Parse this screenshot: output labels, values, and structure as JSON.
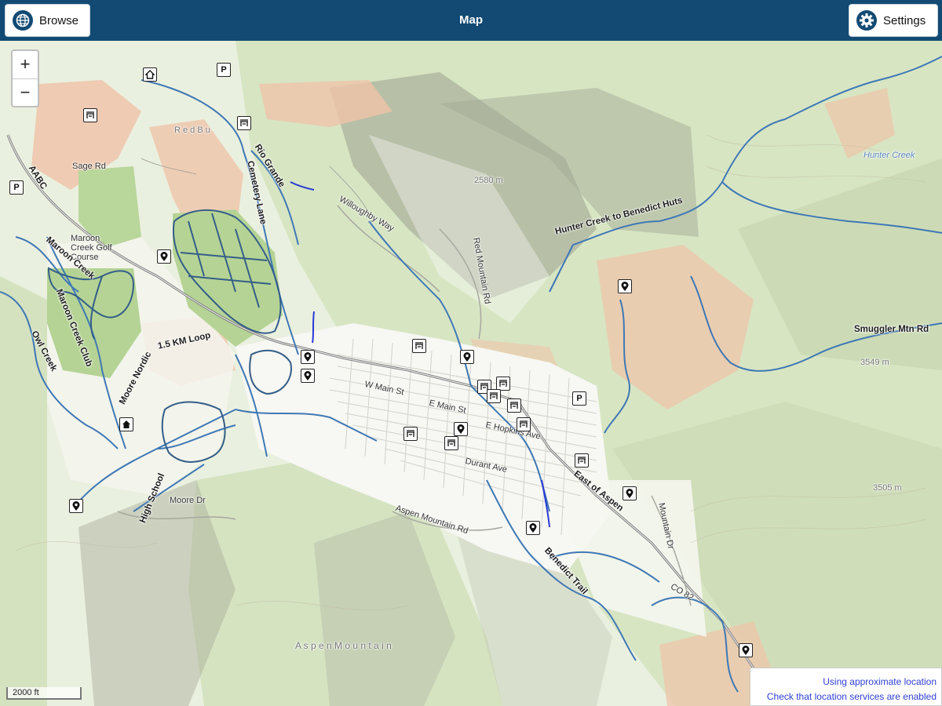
{
  "header": {
    "title": "Map",
    "browse_label": "Browse",
    "settings_label": "Settings"
  },
  "zoom": {
    "in": "+",
    "out": "−"
  },
  "scale_label": "2000 ft",
  "location_notice": {
    "line1": "Using approximate location",
    "line2": "Check that location services are enabled"
  },
  "map_labels": {
    "rio_grande": "Rio Grande",
    "cemetery_lane": "Cemetery Lane",
    "red_butte": "R e d  B u",
    "sage_rd": "Sage Rd",
    "aabc": "AABC",
    "maroon_golf": "Maroon Creek Golf Course",
    "maroon_creek_club": "Maroon Creek Club",
    "maroon_creek": "Maroon Creek",
    "owl_creek": "Owl Creek",
    "moore_nordic": "Moore Nordic",
    "loop": "1.5 KM Loop",
    "high_school": "High School",
    "moore_dr": "Moore Dr",
    "smuggler": "Smuggler Mtn Rd",
    "hunter_creek_trail": "Hunter Creek to Benedict Huts",
    "hunter_creek": "Hunter Creek",
    "elev_2580": "2580 m",
    "elev_3549": "3549 m",
    "elev_3505": "3505 m",
    "willoughby": "Willoughby Way",
    "red_mountain": "Red Mountain Rd",
    "w_main": "W Main St",
    "e_main": "E Main St",
    "e_hopkins": "E Hopkins Ave",
    "durant": "Durant Ave",
    "east_of_aspen": "East of Aspen",
    "benedict_trail": "Benedict Trail",
    "aspen_mountain_rd": "Aspen Mountain Rd",
    "aspen_mountain": "A s p e n   M o u n t a i n",
    "mountain_dr": "Mountain Dr",
    "co82": "CO 82",
    "golf_course_trail": "Golf Course"
  },
  "icons": {
    "parking": "P",
    "marker": "map-marker",
    "shelter": "picnic-shelter",
    "home": "home"
  },
  "colors": {
    "header": "#124a73",
    "trail": "#3f78b5",
    "park": "#b5d394",
    "forest": "#d3e2bf",
    "private": "#efc4aa"
  }
}
